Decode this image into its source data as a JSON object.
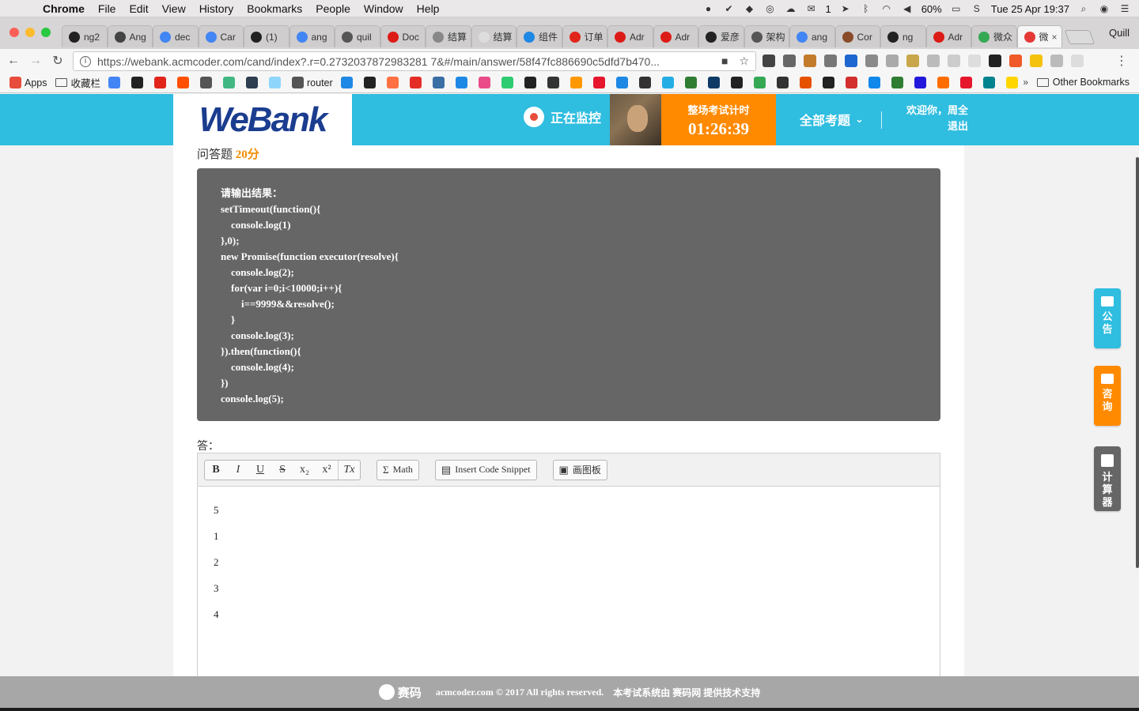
{
  "menubar": {
    "app": "Chrome",
    "items": [
      "File",
      "Edit",
      "View",
      "History",
      "Bookmarks",
      "People",
      "Window",
      "Help"
    ],
    "wechat_count": "1",
    "battery": "60%",
    "datetime": "Tue 25 Apr  19:37"
  },
  "tabs": [
    {
      "label": "ng2",
      "icon": "github-icon",
      "color": "#222222"
    },
    {
      "label": "Ang",
      "icon": "download-icon",
      "color": "#444444"
    },
    {
      "label": "dec",
      "icon": "google-icon",
      "color": "#4285f4"
    },
    {
      "label": "Car",
      "icon": "google-icon",
      "color": "#4285f4"
    },
    {
      "label": "(1)",
      "icon": "github-icon",
      "color": "#222222"
    },
    {
      "label": "ang",
      "icon": "google-icon",
      "color": "#4285f4"
    },
    {
      "label": "quil",
      "icon": "quill-icon",
      "color": "#555555"
    },
    {
      "label": "Doc",
      "icon": "angular-icon",
      "color": "#dd1b16"
    },
    {
      "label": "结算",
      "icon": "doc-icon",
      "color": "#888888"
    },
    {
      "label": "结算",
      "icon": "blank-icon",
      "color": "#dddddd"
    },
    {
      "label": "组件",
      "icon": "cube-icon",
      "color": "#1e88e5"
    },
    {
      "label": "订单",
      "icon": "jd-icon",
      "color": "#e1251b"
    },
    {
      "label": "Adr",
      "icon": "angular-icon",
      "color": "#dd1b16"
    },
    {
      "label": "Adr",
      "icon": "angular-icon",
      "color": "#dd1b16"
    },
    {
      "label": "爱彦",
      "icon": "swirl-icon",
      "color": "#222222"
    },
    {
      "label": "架构",
      "icon": "book-icon",
      "color": "#555555"
    },
    {
      "label": "ang",
      "icon": "google-icon",
      "color": "#4285f4"
    },
    {
      "label": "Cor",
      "icon": "avatar-icon",
      "color": "#8a4b2a"
    },
    {
      "label": "ng",
      "icon": "github-icon",
      "color": "#222222"
    },
    {
      "label": "Adr",
      "icon": "angular-icon",
      "color": "#dd1b16"
    },
    {
      "label": "微众",
      "icon": "chrome-icon",
      "color": "#34a853"
    },
    {
      "label": "微",
      "icon": "record-icon",
      "color": "#e53935",
      "active": true
    }
  ],
  "profile": "Quill",
  "address": {
    "url": "https://webank.acmcoder.com/cand/index?.r=0.2732037872983281 7&#/main/answer/58f47fc886690c5dfd7b470..."
  },
  "bookmarks": [
    {
      "label": "Apps",
      "icon": "apps-icon",
      "color": "#e74c3c"
    },
    {
      "label": "收藏栏",
      "icon": "folder-icon",
      "color": "#555555"
    },
    {
      "label": "",
      "icon": "google-icon",
      "color": "#4285f4"
    },
    {
      "label": "",
      "icon": "codepen-icon",
      "color": "#222222"
    },
    {
      "label": "",
      "icon": "jd-icon",
      "color": "#e1251b"
    },
    {
      "label": "",
      "icon": "taobao-icon",
      "color": "#ff5000"
    },
    {
      "label": "",
      "icon": "diamond-icon",
      "color": "#555555"
    },
    {
      "label": "",
      "icon": "vue-icon",
      "color": "#41b883"
    },
    {
      "label": "",
      "icon": "react-icon",
      "color": "#2c3e50"
    },
    {
      "label": "",
      "icon": "webpack-icon",
      "color": "#8ed6fb"
    },
    {
      "label": "router",
      "icon": "book-icon",
      "color": "#555555"
    },
    {
      "label": "",
      "icon": "hex-icon",
      "color": "#1e88e5"
    },
    {
      "label": "",
      "icon": "github-icon",
      "color": "#222222"
    },
    {
      "label": "",
      "icon": "plus-icon",
      "color": "#ff7043"
    },
    {
      "label": "",
      "icon": "youtube-icon",
      "color": "#e52d27"
    },
    {
      "label": "",
      "icon": "building-icon",
      "color": "#3a6ea5"
    },
    {
      "label": "",
      "icon": "image-icon",
      "color": "#1e88e5"
    },
    {
      "label": "",
      "icon": "dribbble-icon",
      "color": "#ea4c89"
    },
    {
      "label": "",
      "icon": "chat-icon",
      "color": "#2ecc71"
    },
    {
      "label": "",
      "icon": "circle-icon",
      "color": "#222222"
    },
    {
      "label": "",
      "icon": "terminal-icon",
      "color": "#333333"
    },
    {
      "label": "",
      "icon": "star-icon",
      "color": "#ff9800"
    },
    {
      "label": "",
      "icon": "weibo-icon",
      "color": "#e6162d"
    },
    {
      "label": "",
      "icon": "ring-icon",
      "color": "#1e88e5"
    },
    {
      "label": "",
      "icon": "bird-icon",
      "color": "#333333"
    },
    {
      "label": "",
      "icon": "bilibili-icon",
      "color": "#23ade5"
    },
    {
      "label": "",
      "icon": "chart-icon",
      "color": "#2e7d32"
    },
    {
      "label": "",
      "icon": "wave-icon",
      "color": "#0d3b66"
    },
    {
      "label": "",
      "icon": "wiki-icon",
      "color": "#222222"
    },
    {
      "label": "",
      "icon": "chrome-icon",
      "color": "#34a853"
    },
    {
      "label": "",
      "icon": "road-icon",
      "color": "#333333"
    },
    {
      "label": "",
      "icon": "target-icon",
      "color": "#e65100"
    },
    {
      "label": "",
      "icon": "museum-icon",
      "color": "#222222"
    },
    {
      "label": "",
      "icon": "netease-icon",
      "color": "#d32f2f"
    },
    {
      "label": "",
      "icon": "zhihu-icon",
      "color": "#0f88eb"
    },
    {
      "label": "",
      "icon": "douban-icon",
      "color": "#2e7d32"
    },
    {
      "label": "",
      "icon": "baidu-icon",
      "color": "#2319dc"
    },
    {
      "label": "",
      "icon": "hot-icon",
      "color": "#ff6d00"
    },
    {
      "label": "",
      "icon": "weibo-icon",
      "color": "#e6162d"
    },
    {
      "label": "",
      "icon": "search-icon",
      "color": "#00838f"
    },
    {
      "label": "",
      "icon": "yellow-icon",
      "color": "#ffd600"
    }
  ],
  "other_bookmarks": "Other Bookmarks",
  "header": {
    "logo": "WeBank",
    "monitor": "正在监控",
    "timer_label": "整场考试计时",
    "timer_value": "01:26:39",
    "all_questions": "全部考题",
    "welcome": "欢迎你，周全",
    "logout": "退出"
  },
  "question": {
    "type": "问答题",
    "points": "20分",
    "code": "请输出结果：\nsetTimeout(function(){\n    console.log(1)\n},0);\nnew Promise(function executor(resolve){\n    console.log(2);\n    for(var i=0;i<10000;i++){\n        i==9999&&resolve();\n    }\n    console.log(3);\n}).then(function(){\n    console.log(4);\n})\nconsole.log(5);"
  },
  "answer": {
    "label": "答：",
    "toolbar": {
      "bold": "B",
      "italic": "I",
      "underline": "U",
      "strike": "S",
      "subscript": "x₂",
      "superscript": "x²",
      "clear": "Tx",
      "math": "Math",
      "code_snippet": "Insert Code Snippet",
      "drawing": "画图板"
    },
    "lines": [
      "5",
      "1",
      "2",
      "3",
      "4"
    ]
  },
  "side": {
    "notice": "公告",
    "consult": "咨询",
    "calculator": "计算器"
  },
  "footer": {
    "brand": "赛码",
    "copyright": "acmcoder.com © 2017 All rights reserved.",
    "support": "本考试系统由 赛码网 提供技术支持"
  },
  "colors": {
    "header_blue": "#2fbde0",
    "timer_orange": "#ff8a00",
    "code_bg": "#666666",
    "points_orange": "#f08c00"
  }
}
